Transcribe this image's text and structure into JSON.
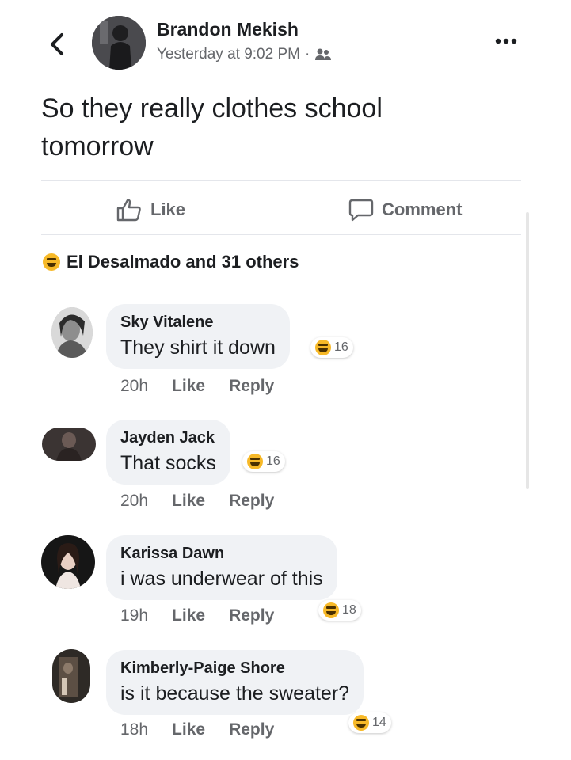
{
  "post": {
    "author": "Brandon Mekish",
    "time": "Yesterday at 9:02 PM",
    "separator": "·",
    "privacy_icon": "friends-icon",
    "text": "So they really clothes school tomorrow"
  },
  "actions": {
    "like_label": "Like",
    "comment_label": "Comment"
  },
  "reactions": {
    "icon": "haha-icon",
    "summary": "El Desalmado and 31 others"
  },
  "comments": [
    {
      "name": "Sky Vitalene",
      "text": "They shirt it down",
      "time": "20h",
      "like": "Like",
      "reply": "Reply",
      "reaction_count": "16"
    },
    {
      "name": "Jayden Jack",
      "text": "That socks",
      "time": "20h",
      "like": "Like",
      "reply": "Reply",
      "reaction_count": "16"
    },
    {
      "name": "Karissa Dawn",
      "text": "i was underwear of this",
      "time": "19h",
      "like": "Like",
      "reply": "Reply",
      "reaction_count": "18"
    },
    {
      "name": "Kimberly-Paige Shore",
      "text": "is it because the sweater?",
      "time": "18h",
      "like": "Like",
      "reply": "Reply",
      "reaction_count": "14"
    }
  ],
  "colors": {
    "text_primary": "#1c1e21",
    "text_secondary": "#65676b",
    "bubble_bg": "#f0f2f5",
    "haha_yellow": "#f7b928"
  }
}
